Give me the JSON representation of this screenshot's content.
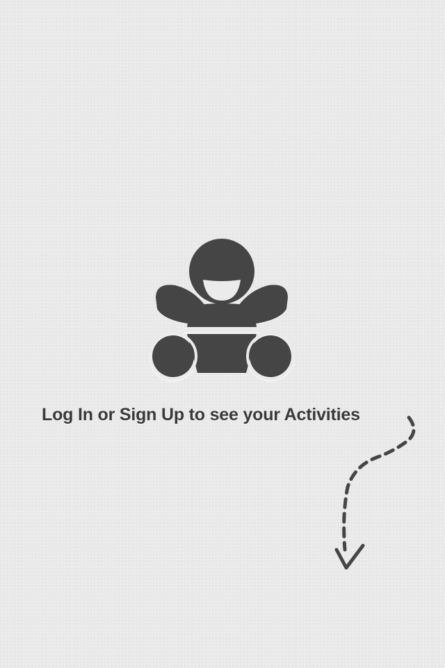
{
  "empty_state": {
    "icon": "baby-icon",
    "message": "Log In or Sign Up to see your Activities",
    "hint_icon": "dashed-arrow-down-icon"
  },
  "colors": {
    "background": "#ebebeb",
    "icon": "#454545",
    "text": "#3a3a3a"
  }
}
